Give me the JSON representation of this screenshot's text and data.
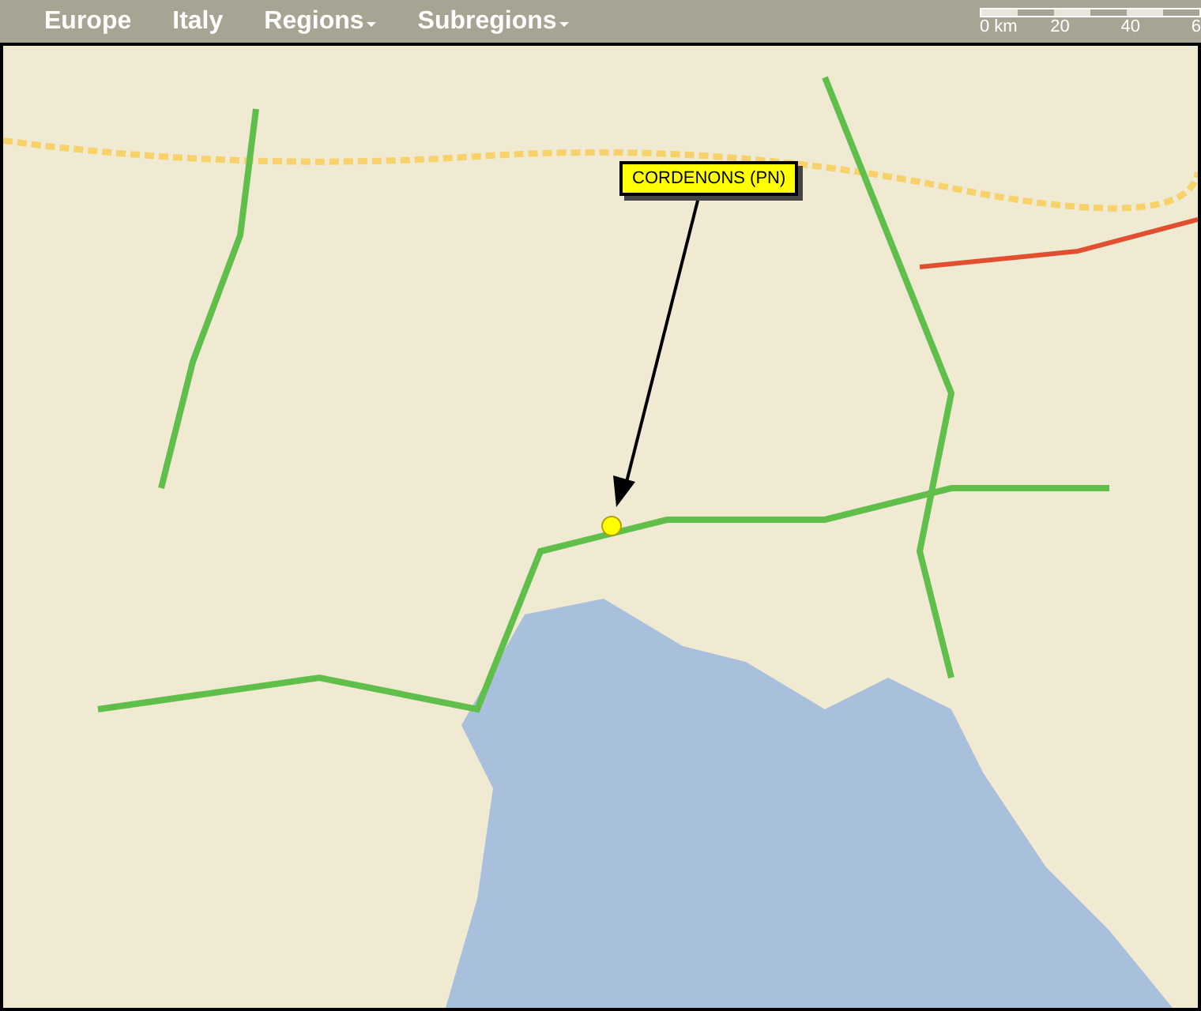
{
  "nav": [
    {
      "label": "Europe",
      "kind": "link"
    },
    {
      "label": "Italy",
      "kind": "link"
    },
    {
      "label": "Regions",
      "kind": "dropdown"
    },
    {
      "label": "Subregions",
      "kind": "dropdown"
    }
  ],
  "scale": {
    "labels": [
      "0 km",
      "20",
      "40",
      "6"
    ]
  },
  "map": {
    "marker": {
      "label": "CORDENONS (PN)"
    }
  }
}
